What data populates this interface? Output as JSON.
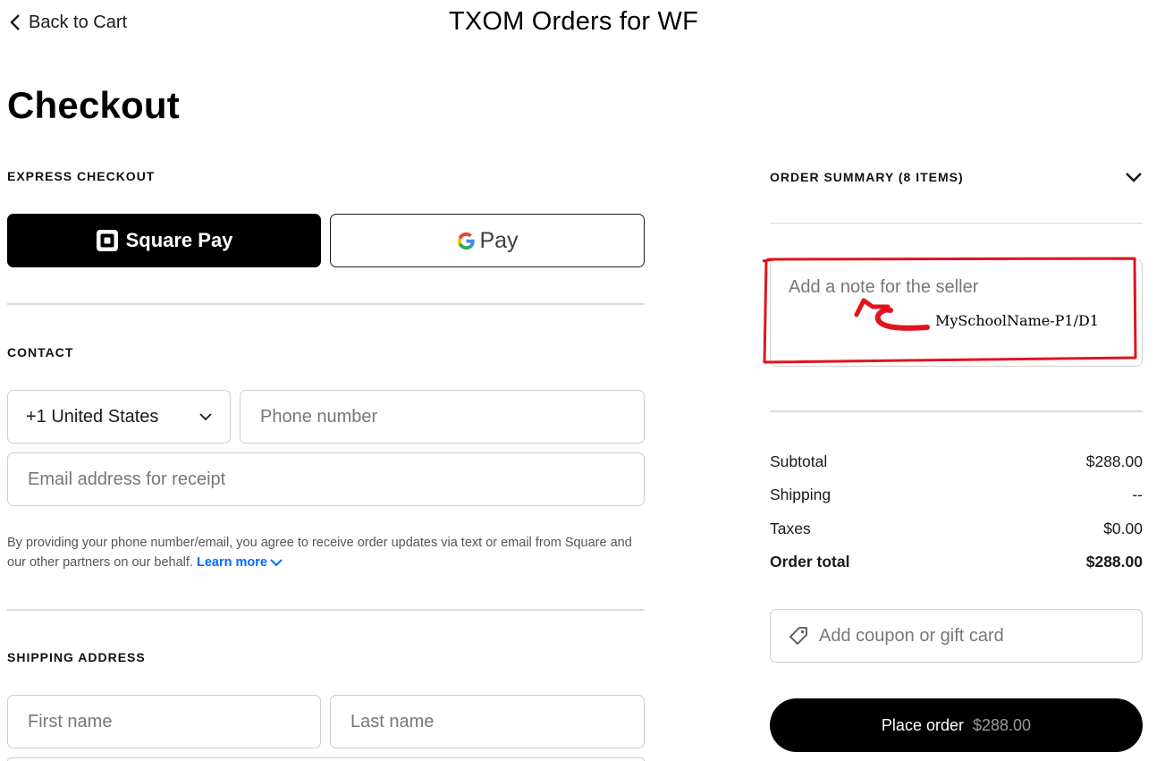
{
  "header": {
    "back_label": "Back to Cart",
    "store_title": "TXOM Orders for WF"
  },
  "page_title": "Checkout",
  "express_checkout": {
    "label": "EXPRESS CHECKOUT",
    "square_pay_label": "Square Pay",
    "google_pay_label": "Pay"
  },
  "contact": {
    "label": "CONTACT",
    "country_value": "+1 United States",
    "phone_placeholder": "Phone number",
    "email_placeholder": "Email address for receipt",
    "consent_text": "By providing your phone number/email, you agree to receive order updates via text or email from Square and our other partners on our behalf.",
    "learn_more_label": "Learn more"
  },
  "shipping": {
    "label": "SHIPPING ADDRESS",
    "first_name_placeholder": "First name",
    "last_name_placeholder": "Last name"
  },
  "summary": {
    "header": "ORDER SUMMARY (8 ITEMS)",
    "note_placeholder": "Add a note for the seller",
    "rows": [
      {
        "label": "Subtotal",
        "value": "$288.00"
      },
      {
        "label": "Shipping",
        "value": "--"
      },
      {
        "label": "Taxes",
        "value": "$0.00"
      },
      {
        "label": "Order total",
        "value": "$288.00"
      }
    ],
    "coupon_label": "Add coupon or gift card",
    "place_order_label": "Place order",
    "place_order_price": "$288.00"
  },
  "annotation": {
    "text": "MySchoolName-P1/D1",
    "color": "#e0141e"
  },
  "colors": {
    "accent_link": "#006aff",
    "primary_button": "#000000",
    "border": "#cfcfcf"
  }
}
